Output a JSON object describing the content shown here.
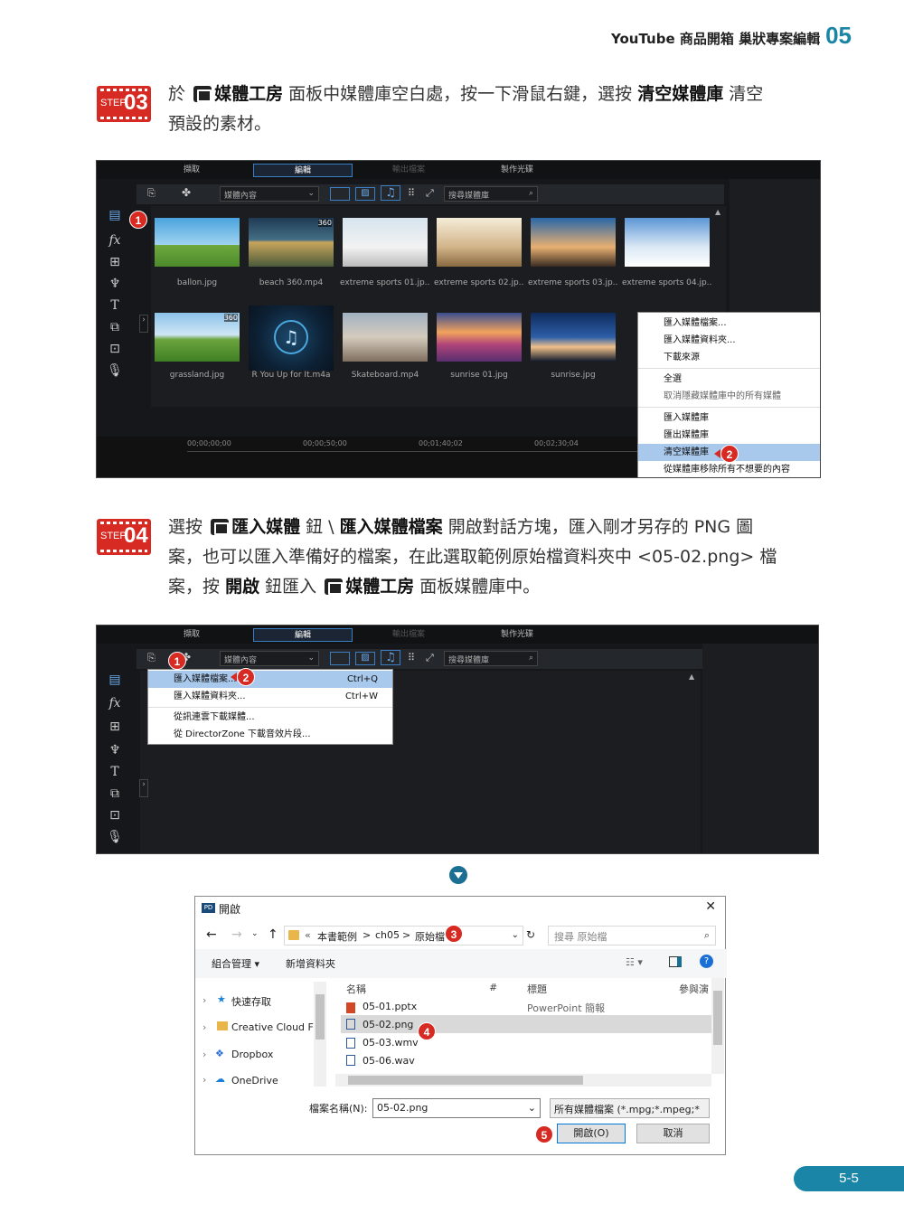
{
  "header": {
    "title": "YouTube 商品開箱 巢狀專案編輯",
    "chapter": "05"
  },
  "step3": {
    "label": "STEP",
    "num": "03",
    "text_a": "於",
    "b1": "媒體工房",
    "text_b": "面板中媒體庫空白處，按一下滑鼠右鍵，選按",
    "b2": "清空媒體庫",
    "text_c": "清空",
    "text_d": "預設的素材。"
  },
  "step4": {
    "label": "STEP",
    "num": "04",
    "t1": "選按",
    "b1": "匯入媒體",
    "t2": "鈕 \\",
    "b2": "匯入媒體檔案",
    "t3": "開啟對話方塊，匯入剛才另存的 PNG 圖",
    "t4": "案，也可以匯入準備好的檔案，在此選取範例原始檔資料夾中 <05-02.png> 檔",
    "t5": "案，按",
    "b3": "開啟",
    "t6": "鈕匯入",
    "b4": "媒體工房",
    "t7": "面板媒體庫中。"
  },
  "app": {
    "tabs": [
      "擷取",
      "編輯",
      "輸出檔案",
      "製作光碟"
    ],
    "dropdown": "媒體內容",
    "search_placeholder": "搜尋媒體庫"
  },
  "shot1": {
    "media": [
      {
        "name": "ballon.jpg",
        "badge": ""
      },
      {
        "name": "beach 360.mp4",
        "badge": "360"
      },
      {
        "name": "extreme sports 01.jp...",
        "badge": ""
      },
      {
        "name": "extreme sports 02.jp...",
        "badge": ""
      },
      {
        "name": "extreme sports 03.jp...",
        "badge": ""
      },
      {
        "name": "extreme sports 04.jp...",
        "badge": ""
      },
      {
        "name": "grassland.jpg",
        "badge": "360"
      },
      {
        "name": "R You Up for It.m4a",
        "badge": ""
      },
      {
        "name": "Skateboard.mp4",
        "badge": ""
      },
      {
        "name": "sunrise 01.jpg",
        "badge": ""
      },
      {
        "name": "sunrise.jpg",
        "badge": ""
      }
    ],
    "context_menu": [
      "匯入媒體檔案...",
      "匯入媒體資料夾...",
      "下載來源",
      "全選",
      "取消隱藏媒體庫中的所有媒體",
      "匯入媒體庫",
      "匯出媒體庫",
      "清空媒體庫",
      "從媒體庫移除所有不想要的內容"
    ],
    "timecodes": [
      "00;00;00;00",
      "00;00;50;00",
      "00;01;40;02",
      "00;02;30;04"
    ],
    "badges": [
      "1",
      "2"
    ]
  },
  "shot2": {
    "menu": [
      {
        "label": "匯入媒體檔案...",
        "shortcut": "Ctrl+Q"
      },
      {
        "label": "匯入媒體資料夾...",
        "shortcut": "Ctrl+W"
      },
      {
        "label": "從訊連雲下載媒體...",
        "shortcut": ""
      },
      {
        "label": "從 DirectorZone 下載音效片段...",
        "shortcut": ""
      }
    ],
    "badges": [
      "1",
      "2"
    ]
  },
  "dialog": {
    "title": "開啟",
    "path": [
      "«",
      "本書範例",
      ">",
      "ch05",
      ">",
      "原始檔"
    ],
    "search_placeholder": "搜尋 原始檔",
    "organize": "組合管理 ▾",
    "new_folder": "新增資料夾",
    "nav": [
      "快速存取",
      "Creative Cloud Fi",
      "Dropbox",
      "OneDrive"
    ],
    "columns": [
      "名稱",
      "#",
      "標題",
      "參與演"
    ],
    "files": [
      {
        "name": "05-01.pptx",
        "title": "PowerPoint 簡報"
      },
      {
        "name": "05-02.png",
        "title": ""
      },
      {
        "name": "05-03.wmv",
        "title": ""
      },
      {
        "name": "05-06.wav",
        "title": ""
      }
    ],
    "filename_label": "檔案名稱(N):",
    "filename": "05-02.png",
    "filetype": "所有媒體檔案 (*.mpg;*.mpeg;*",
    "open": "開啟(O)",
    "cancel": "取消",
    "badges": [
      "3",
      "4",
      "5"
    ]
  },
  "page": "5-5"
}
